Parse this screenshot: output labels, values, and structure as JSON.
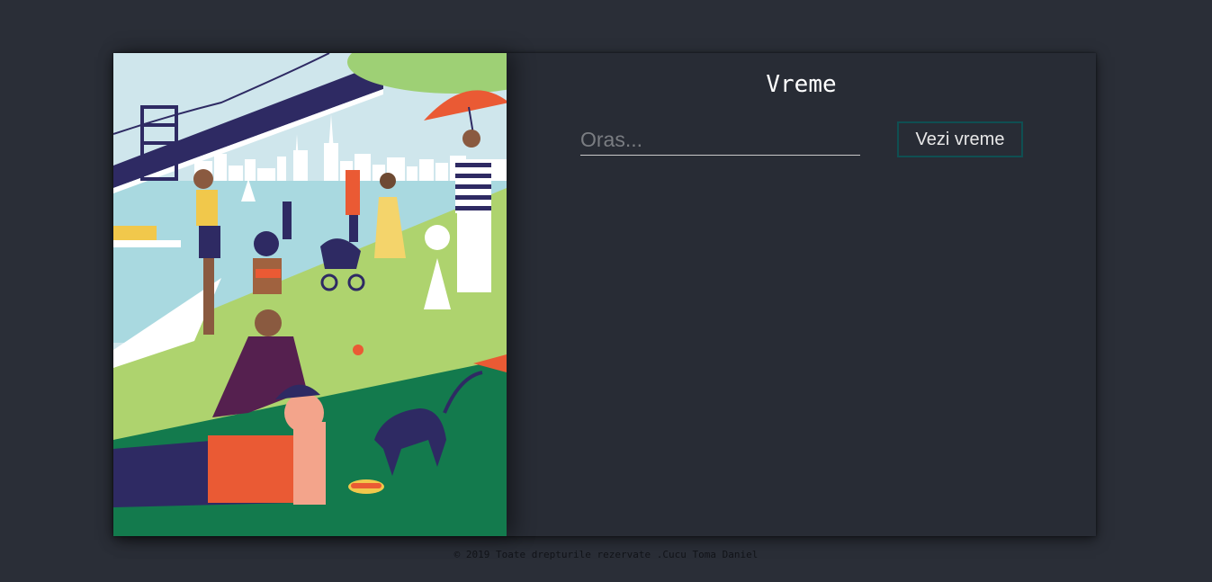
{
  "weather": {
    "title": "Vreme",
    "city_placeholder": "Oras...",
    "city_value": "",
    "submit_label": "Vezi vreme"
  },
  "footer": {
    "copyright": "© 2019 Toate drepturile rezervate .Cucu Toma Daniel"
  },
  "colors": {
    "background": "#2a2e37",
    "card": "#282c35",
    "button_border": "#0f4f52"
  }
}
